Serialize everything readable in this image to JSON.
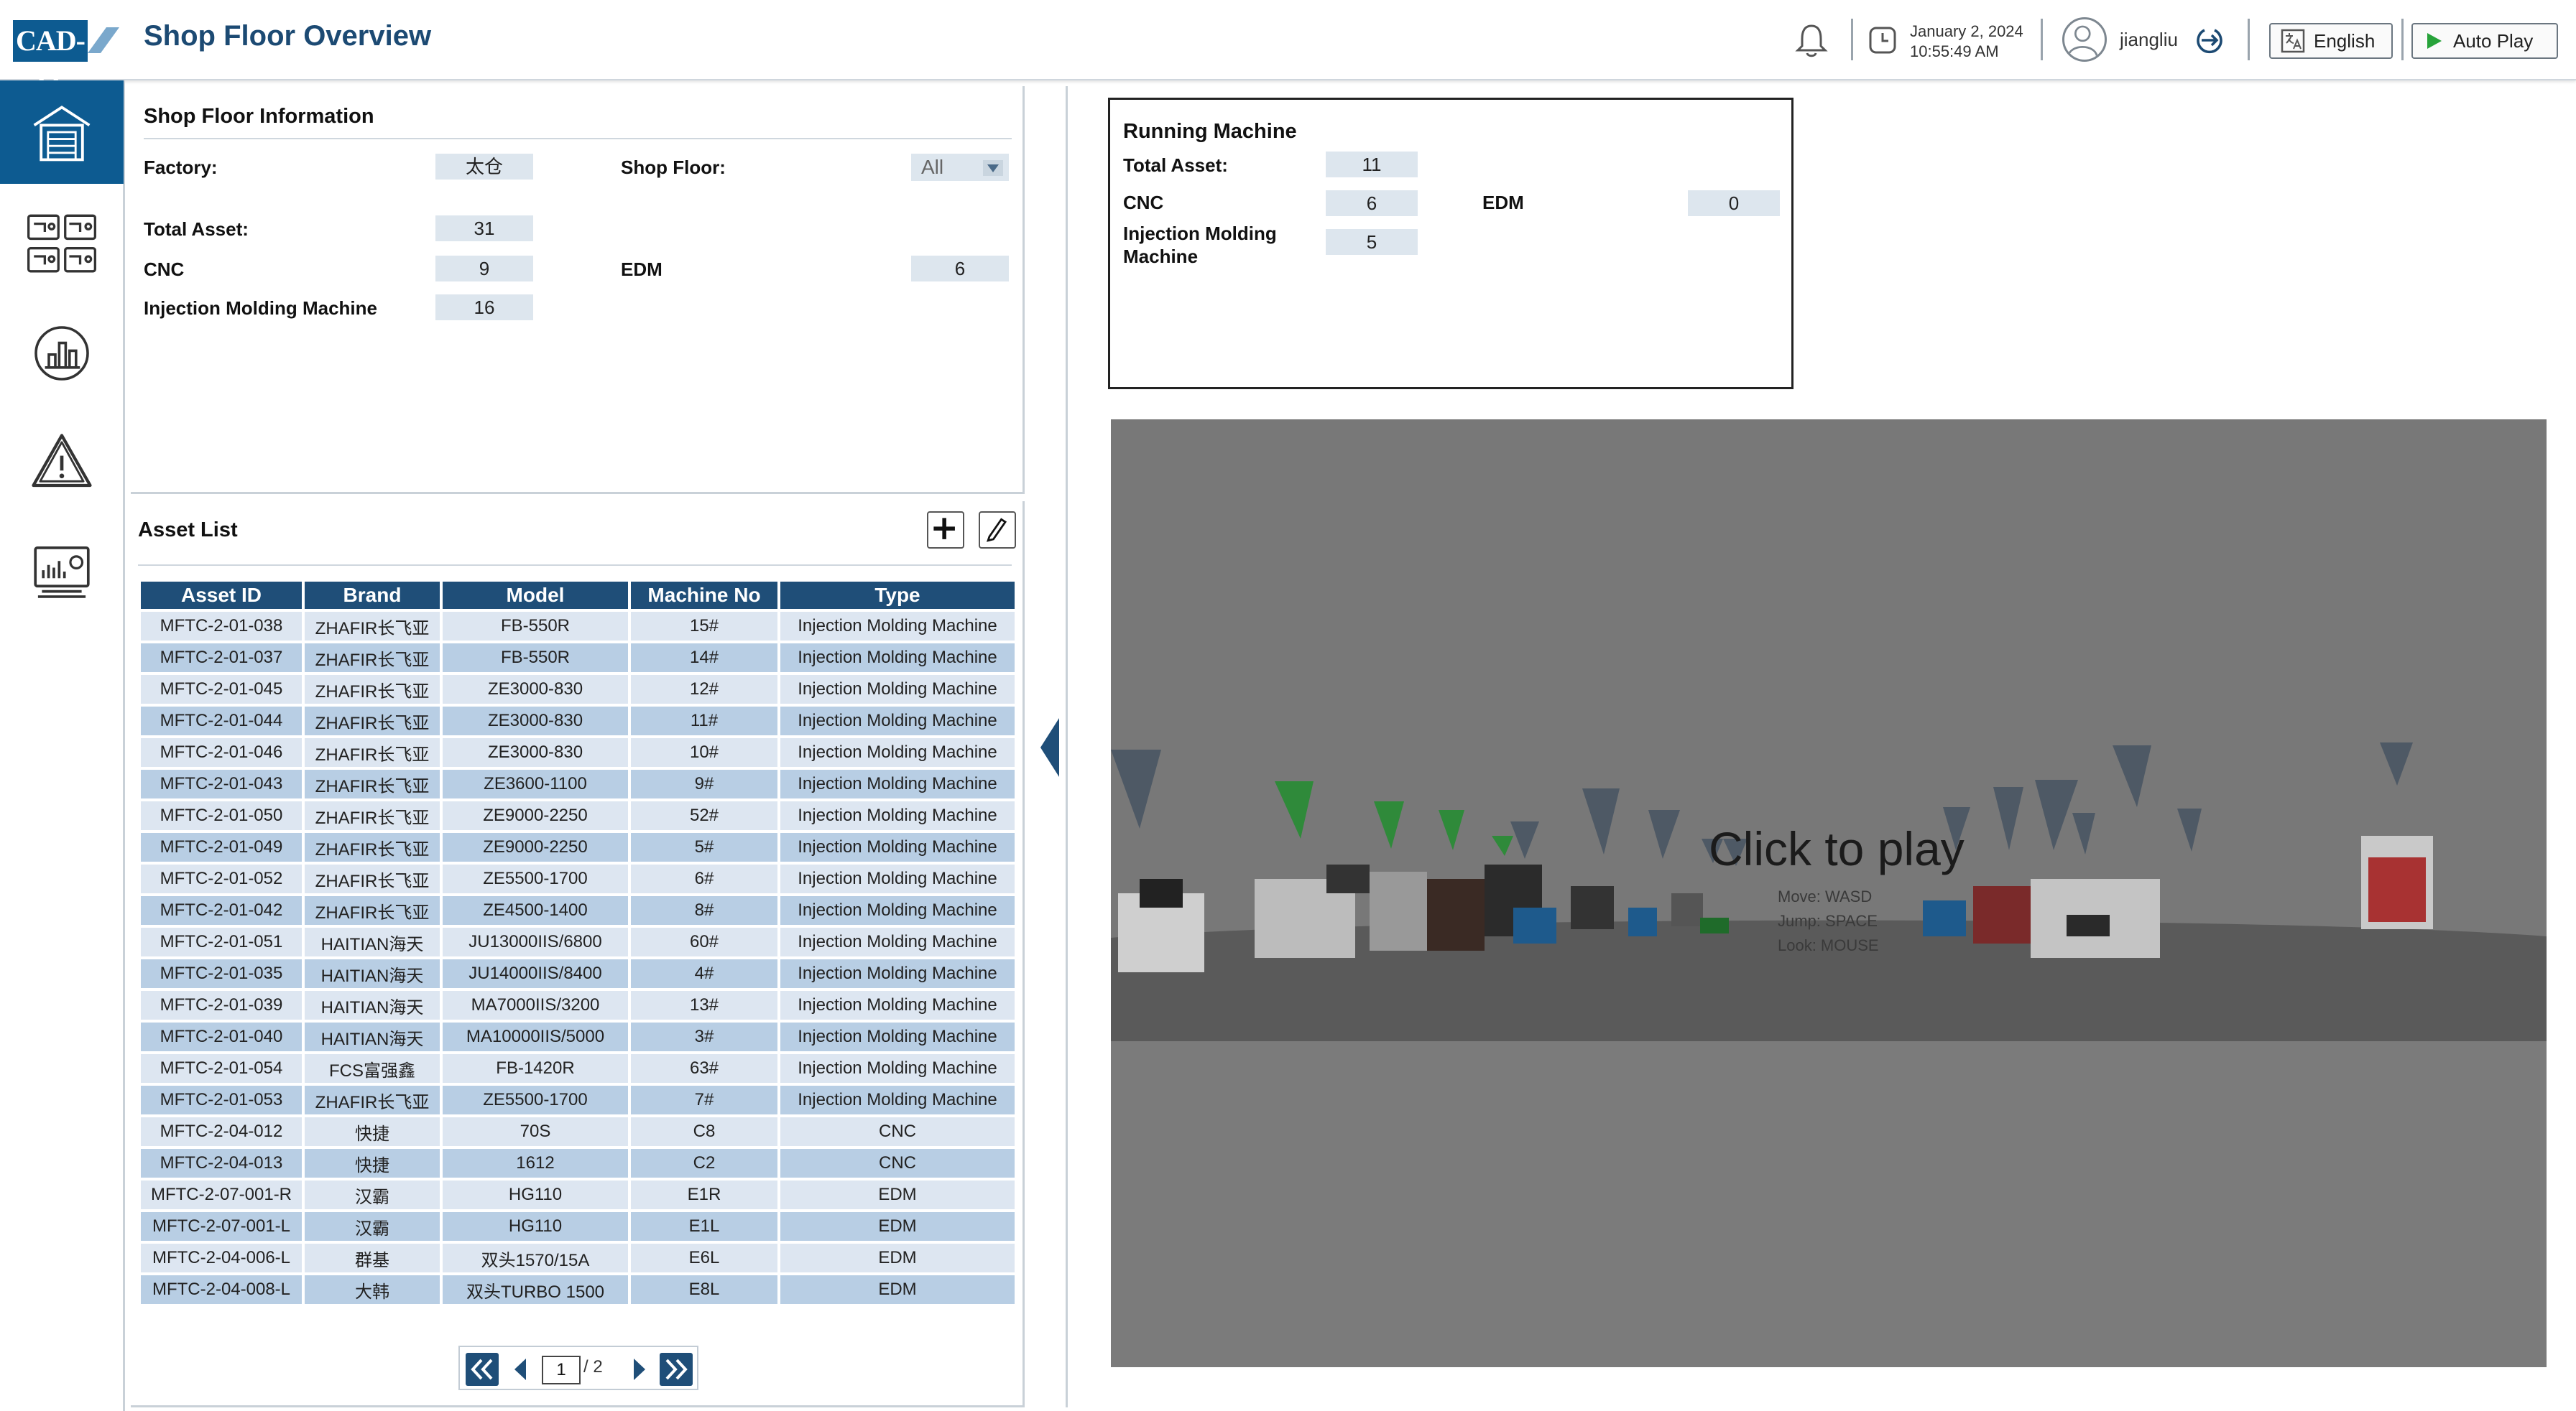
{
  "header": {
    "logo_text": "CAD-IT",
    "title": "Shop Floor Overview",
    "date": "January 2, 2024",
    "time": "10:55:49 AM",
    "user": "jiangliu",
    "language_label": "English",
    "autoplay_label": "Auto Play",
    "icons": [
      "bell-icon",
      "clock-icon",
      "avatar-icon",
      "logout-icon",
      "language-icon",
      "play-icon"
    ]
  },
  "sidebar": {
    "items": [
      {
        "icon": "factory-icon",
        "active": true
      },
      {
        "icon": "machines-grid-icon",
        "active": false
      },
      {
        "icon": "bar-chart-icon",
        "active": false
      },
      {
        "icon": "warning-icon",
        "active": false
      },
      {
        "icon": "monitor-chart-icon",
        "active": false
      }
    ],
    "active_color": "#0d5b91"
  },
  "shop_floor_info": {
    "title": "Shop Floor Information",
    "factory_label": "Factory:",
    "factory_value": "太仓",
    "shop_floor_label": "Shop Floor:",
    "shop_floor_value": "All",
    "total_asset_label": "Total Asset:",
    "total_asset_value": "31",
    "cnc_label": "CNC",
    "cnc_value": "9",
    "edm_label": "EDM",
    "edm_value": "6",
    "imm_label": "Injection Molding Machine",
    "imm_value": "16"
  },
  "asset_list": {
    "title": "Asset List",
    "columns": [
      "Asset ID",
      "Brand",
      "Model",
      "Machine No",
      "Type"
    ],
    "rows": [
      [
        "MFTC-2-01-038",
        "ZHAFIR长飞亚",
        "FB-550R",
        "15#",
        "Injection Molding Machine"
      ],
      [
        "MFTC-2-01-037",
        "ZHAFIR长飞亚",
        "FB-550R",
        "14#",
        "Injection Molding Machine"
      ],
      [
        "MFTC-2-01-045",
        "ZHAFIR长飞亚",
        "ZE3000-830",
        "12#",
        "Injection Molding Machine"
      ],
      [
        "MFTC-2-01-044",
        "ZHAFIR长飞亚",
        "ZE3000-830",
        "11#",
        "Injection Molding Machine"
      ],
      [
        "MFTC-2-01-046",
        "ZHAFIR长飞亚",
        "ZE3000-830",
        "10#",
        "Injection Molding Machine"
      ],
      [
        "MFTC-2-01-043",
        "ZHAFIR长飞亚",
        "ZE3600-1100",
        "9#",
        "Injection Molding Machine"
      ],
      [
        "MFTC-2-01-050",
        "ZHAFIR长飞亚",
        "ZE9000-2250",
        "52#",
        "Injection Molding Machine"
      ],
      [
        "MFTC-2-01-049",
        "ZHAFIR长飞亚",
        "ZE9000-2250",
        "5#",
        "Injection Molding Machine"
      ],
      [
        "MFTC-2-01-052",
        "ZHAFIR长飞亚",
        "ZE5500-1700",
        "6#",
        "Injection Molding Machine"
      ],
      [
        "MFTC-2-01-042",
        "ZHAFIR长飞亚",
        "ZE4500-1400",
        "8#",
        "Injection Molding Machine"
      ],
      [
        "MFTC-2-01-051",
        "HAITIAN海天",
        "JU13000IIS/6800",
        "60#",
        "Injection Molding Machine"
      ],
      [
        "MFTC-2-01-035",
        "HAITIAN海天",
        "JU14000IIS/8400",
        "4#",
        "Injection Molding Machine"
      ],
      [
        "MFTC-2-01-039",
        "HAITIAN海天",
        "MA7000IIS/3200",
        "13#",
        "Injection Molding Machine"
      ],
      [
        "MFTC-2-01-040",
        "HAITIAN海天",
        "MA10000IIS/5000",
        "3#",
        "Injection Molding Machine"
      ],
      [
        "MFTC-2-01-054",
        "FCS富强鑫",
        "FB-1420R",
        "63#",
        "Injection Molding Machine"
      ],
      [
        "MFTC-2-01-053",
        "ZHAFIR长飞亚",
        "ZE5500-1700",
        "7#",
        "Injection Molding Machine"
      ],
      [
        "MFTC-2-04-012",
        "快捷",
        "70S",
        "C8",
        "CNC"
      ],
      [
        "MFTC-2-04-013",
        "快捷",
        "1612",
        "C2",
        "CNC"
      ],
      [
        "MFTC-2-07-001-R",
        "汉霸",
        "HG110",
        "E1R",
        "EDM"
      ],
      [
        "MFTC-2-07-001-L",
        "汉霸",
        "HG110",
        "E1L",
        "EDM"
      ],
      [
        "MFTC-2-04-006-L",
        "群基",
        "双头1570/15A",
        "E6L",
        "EDM"
      ],
      [
        "MFTC-2-04-008-L",
        "大韩",
        "双头TURBO 1500",
        "E8L",
        "EDM"
      ]
    ],
    "pager": {
      "current_page": "1",
      "total_label": "/ 2"
    },
    "header_color": "#1f4e78",
    "row_colors": [
      "#dde6f1",
      "#b8cee4"
    ]
  },
  "running_machine": {
    "title": "Running Machine",
    "total_asset_label": "Total Asset:",
    "total_asset_value": "11",
    "cnc_label": "CNC",
    "cnc_value": "6",
    "edm_label": "EDM",
    "edm_value": "0",
    "imm_label": "Injection Molding Machine",
    "imm_value": "5"
  },
  "viewer": {
    "overlay_title": "Click to play",
    "hint_move": "Move: WASD",
    "hint_jump": "Jump: SPACE",
    "hint_look": "Look: MOUSE"
  }
}
